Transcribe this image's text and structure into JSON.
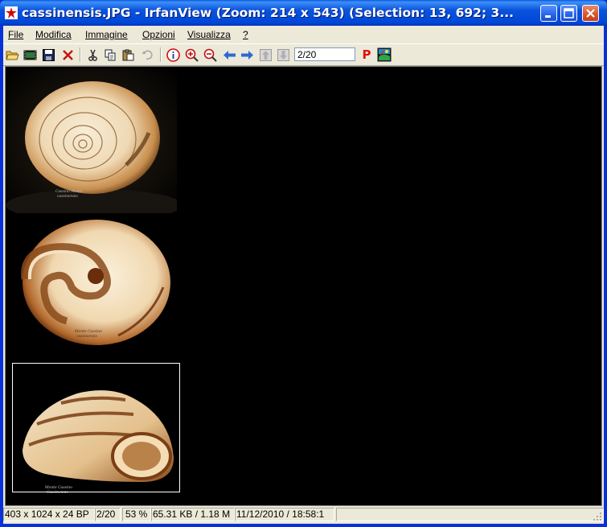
{
  "window": {
    "title": "cassinensis.JPG - IrfanView (Zoom: 214 x 543) (Selection: 13, 692; 3..."
  },
  "menu": [
    {
      "label": "File"
    },
    {
      "label": "Modifica"
    },
    {
      "label": "Immagine"
    },
    {
      "label": "Opzioni"
    },
    {
      "label": "Visualizza"
    },
    {
      "label": "?"
    }
  ],
  "toolbar": {
    "page_value": "2/20",
    "icons": [
      "open-folder-icon",
      "thumbnails-icon",
      "save-icon",
      "delete-icon",
      "cut-icon",
      "copy-icon",
      "paste-icon",
      "undo-icon",
      "info-icon",
      "zoom-in-icon",
      "zoom-out-icon",
      "previous-arrow-icon",
      "next-arrow-icon",
      "first-file-icon",
      "last-file-icon",
      "print-icon",
      "irfanview-logo-icon"
    ],
    "print_glyph": "P"
  },
  "image": {
    "captions": [
      {
        "line1": "Cassino Monte",
        "line2": "cassinensis"
      },
      {
        "line1": "Monte Cassino",
        "line2": "cassinensis"
      },
      {
        "line1": "Monte Cassino",
        "line2": "Cassinensis"
      }
    ]
  },
  "status": {
    "dimensions": "403 x 1024 x 24 BP",
    "index": "2/20",
    "zoom": "53 %",
    "size": "65.31 KB / 1.18 M",
    "datetime": "11/12/2010 / 18:58:1"
  },
  "colors": {
    "title_bar": "#0a53dd",
    "canvas": "#000000",
    "chrome": "#ece9d8"
  }
}
